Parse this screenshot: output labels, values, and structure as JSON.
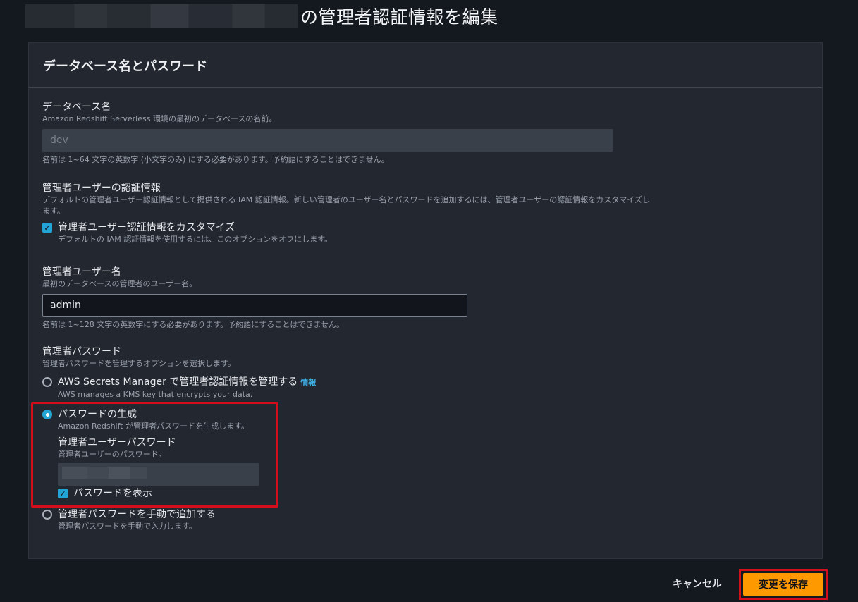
{
  "page": {
    "title": "の管理者認証情報を編集"
  },
  "panel": {
    "title": "データベース名とパスワード"
  },
  "db_name": {
    "label": "データベース名",
    "description": "Amazon Redshift Serverless 環境の最初のデータベースの名前。",
    "value": "dev",
    "constraint": "名前は 1~64 文字の英数字 (小文字のみ) にする必要があります。予約語にすることはできません。"
  },
  "admin_credentials": {
    "label": "管理者ユーザーの認証情報",
    "description": "デフォルトの管理者ユーザー認証情報として提供される IAM 認証情報。新しい管理者のユーザー名とパスワードを追加するには、管理者ユーザーの認証情報をカスタマイズします。",
    "customize_label": "管理者ユーザー認証情報をカスタマイズ",
    "customize_desc": "デフォルトの IAM 認証情報を使用するには、このオプションをオフにします。",
    "customize_checked": true
  },
  "admin_username": {
    "label": "管理者ユーザー名",
    "description": "最初のデータベースの管理者のユーザー名。",
    "value": "admin",
    "constraint": "名前は 1~128 文字の英数字にする必要があります。予約語にすることはできません。"
  },
  "admin_password": {
    "label": "管理者パスワード",
    "description": "管理者パスワードを管理するオプションを選択します。",
    "options": [
      {
        "label": "AWS Secrets Manager で管理者認証情報を管理する",
        "info": "情報",
        "desc": "AWS manages a KMS key that encrypts your data.",
        "selected": false
      },
      {
        "label": "パスワードの生成",
        "desc": "Amazon Redshift が管理者パスワードを生成します。",
        "selected": true
      },
      {
        "label": "管理者パスワードを手動で追加する",
        "desc": "管理者パスワードを手動で入力します。",
        "selected": false
      }
    ],
    "generated": {
      "label": "管理者ユーザーパスワード",
      "description": "管理者ユーザーのパスワード。",
      "show_password_label": "パスワードを表示",
      "show_password_checked": true
    }
  },
  "footer": {
    "cancel_label": "キャンセル",
    "save_label": "変更を保存"
  },
  "colors": {
    "accent": "#ff9900",
    "highlight": "#d40f1c",
    "selected": "#22a4d6"
  }
}
